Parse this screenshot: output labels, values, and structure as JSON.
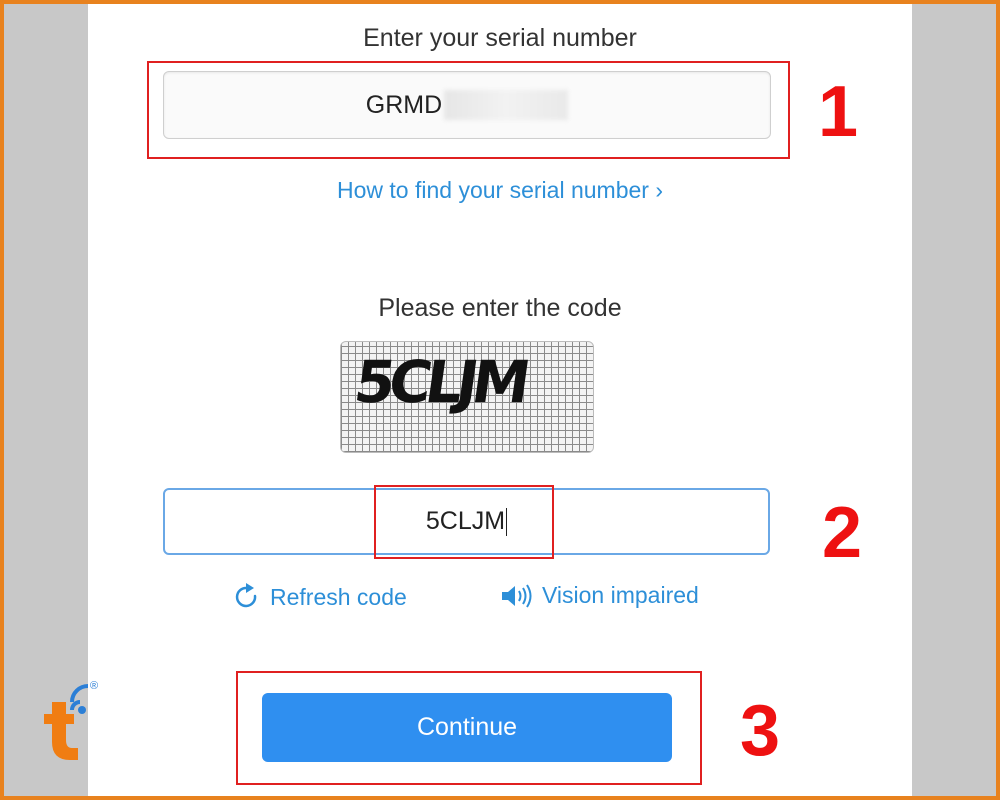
{
  "serial": {
    "label": "Enter your serial number",
    "value_visible": "GRMD",
    "help_link": "How to find your serial number ›"
  },
  "captcha": {
    "label": "Please enter the code",
    "image_text": "5CLJM",
    "input_value": "5CLJM",
    "refresh_label": "Refresh code",
    "vision_label": "Vision impaired"
  },
  "actions": {
    "continue_label": "Continue"
  },
  "annotations": {
    "step1": "1",
    "step2": "2",
    "step3": "3"
  },
  "colors": {
    "accent": "#2f8ff0",
    "link": "#2d8fd8",
    "annotation": "#e02020",
    "frame": "#e8821e"
  },
  "watermark": {
    "icon": "brand-logo-icon",
    "mark": "®"
  }
}
